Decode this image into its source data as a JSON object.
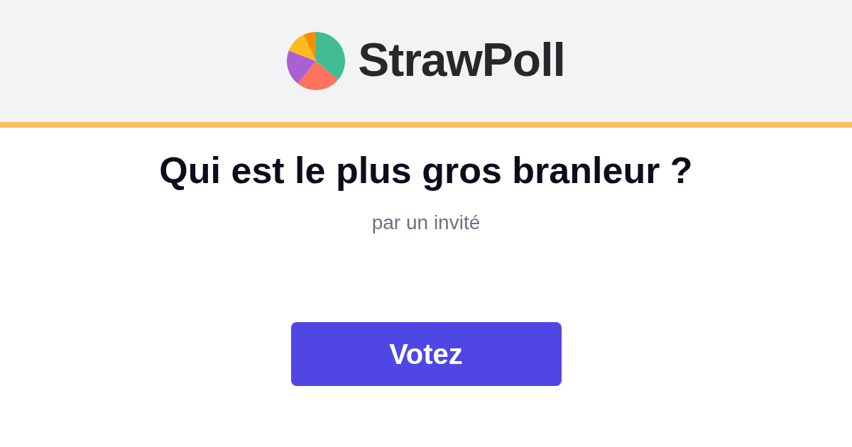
{
  "header": {
    "logo_text": "StrawPoll"
  },
  "poll": {
    "title": "Qui est le plus gros branleur ?",
    "author": "par un invité",
    "vote_button": "Votez"
  }
}
